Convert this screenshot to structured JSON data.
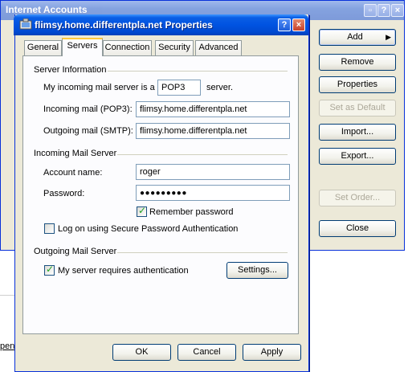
{
  "background_page": {
    "text_fragments": [
      "c",
      "pen"
    ]
  },
  "back_window": {
    "title": "Internet Accounts",
    "titlebar_buttons": [
      "?",
      "×"
    ],
    "buttons": {
      "add": "Add",
      "remove": "Remove",
      "properties": "Properties",
      "set_default": "Set as Default",
      "import": "Import...",
      "export": "Export...",
      "set_order": "Set Order...",
      "close": "Close"
    }
  },
  "dialog": {
    "title": "flimsy.home.differentpla.net Properties",
    "titlebar_buttons": [
      "?",
      "×"
    ],
    "tabs": [
      "General",
      "Servers",
      "Connection",
      "Security",
      "Advanced"
    ],
    "active_tab": "Servers",
    "server_information": {
      "heading": "Server Information",
      "incoming_prefix": "My incoming mail server is a",
      "incoming_type": "POP3",
      "incoming_suffix": "server.",
      "incoming_label": "Incoming mail (POP3):",
      "incoming_value": "flimsy.home.differentpla.net",
      "outgoing_label": "Outgoing mail (SMTP):",
      "outgoing_value": "flimsy.home.differentpla.net"
    },
    "incoming_mail_server": {
      "heading": "Incoming Mail Server",
      "account_label": "Account name:",
      "account_value": "roger",
      "password_label": "Password:",
      "password_value": "●●●●●●●●●",
      "remember_label": "Remember password",
      "remember_checked": true,
      "spa_label": "Log on using Secure Password Authentication",
      "spa_checked": false
    },
    "outgoing_mail_server": {
      "heading": "Outgoing Mail Server",
      "auth_label": "My server requires authentication",
      "auth_checked": true,
      "settings_button": "Settings..."
    },
    "buttons": {
      "ok": "OK",
      "cancel": "Cancel",
      "apply": "Apply"
    }
  }
}
